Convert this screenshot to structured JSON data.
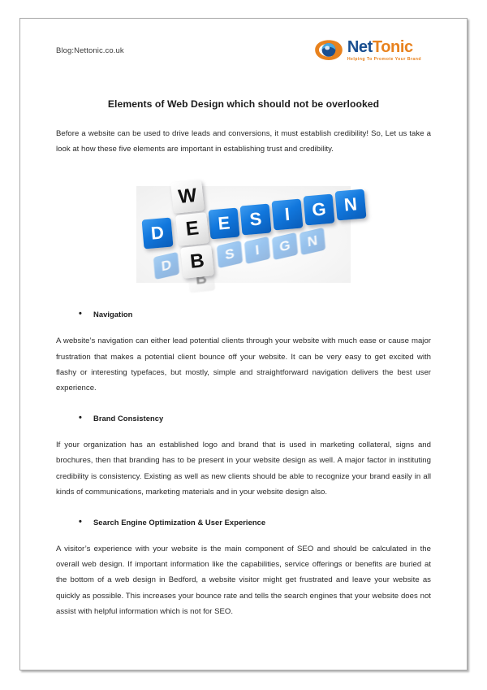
{
  "page": {
    "header": {
      "blog_label": "Blog:Nettonic.co.uk",
      "logo": {
        "mark_name": "nettonic-swoosh-logo",
        "word_first": "Net",
        "word_second": "Tonic",
        "tagline": "Helping To Promote Your Brand",
        "color_blue": "#1a4f90",
        "color_orange": "#e8821e"
      }
    },
    "title": "Elements of Web Design which should not be overlooked",
    "intro": "Before a website can be used to drive leads and conversions, it must establish credibility! So, Let us take a look at how these five elements are important in establishing trust and credibility.",
    "hero_image": {
      "alt": "Blue and white crossword blocks spelling WEB and DESIGN",
      "word_vertical": "WEB",
      "word_horizontal": "DESIGN",
      "blue_hex": "#1177dd",
      "white_hex": "#f2f2f2"
    },
    "sections": [
      {
        "heading": "Navigation",
        "body": "A website’s navigation can either lead potential clients through your website with much ease or cause major frustration that makes a potential client bounce off your website. It can be very easy to get excited with flashy or interesting typefaces, but mostly, simple and straightforward navigation delivers the best user experience."
      },
      {
        "heading": "Brand Consistency",
        "body": "If your organization has an established logo and brand that is used in marketing collateral, signs and brochures, then that branding has to be present in your website design as well. A major factor in instituting credibility is consistency. Existing as well as new clients should be able to recognize your brand easily in all kinds of communications, marketing materials and in your website design also."
      },
      {
        "heading": "Search Engine Optimization & User Experience",
        "body": "A visitor’s experience with your website is the main component of SEO and should be calculated in the overall web design. If important information like the capabilities, service offerings or benefits are buried at the bottom of a web design in Bedford, a website visitor might get frustrated and leave your website as quickly as possible. This increases your bounce rate and tells the search engines that your website does not assist with helpful information which is not for SEO."
      }
    ]
  }
}
